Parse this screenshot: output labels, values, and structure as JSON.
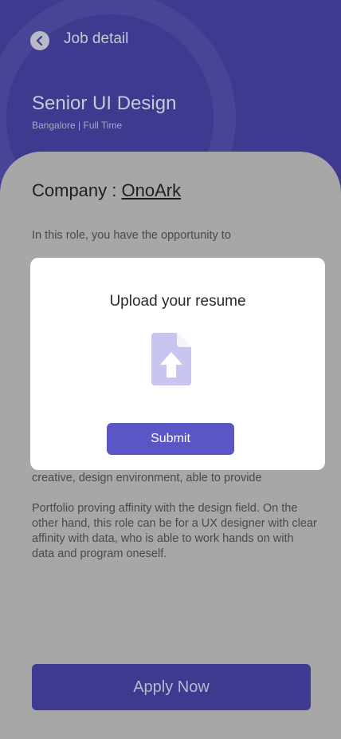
{
  "header": {
    "title": "Job detail",
    "back_icon": "chevron-left-icon"
  },
  "job": {
    "title": "Senior UI Design",
    "subtitle": "Bangalore | Full Time"
  },
  "content": {
    "company_label": "Company :",
    "company_name": "OnoArk",
    "paragraph_top": "In this role, you have the opportunity to",
    "paragraph_middle": "creative, design environment, able to provide",
    "paragraph_bottom": "Portfolio proving affinity with the design field. On the other hand, this role can be for a UX designer with clear affinity with data, who is able to work hands on with data and program oneself."
  },
  "modal": {
    "title": "Upload your resume",
    "icon": "file-upload-icon",
    "submit_label": "Submit"
  },
  "actions": {
    "apply_label": "Apply Now"
  },
  "colors": {
    "primary": "#5a56c6",
    "header_dim": "#3d3a90",
    "overlay_gray": "#a7a7a7",
    "upload_icon": "#c8c6f0"
  }
}
